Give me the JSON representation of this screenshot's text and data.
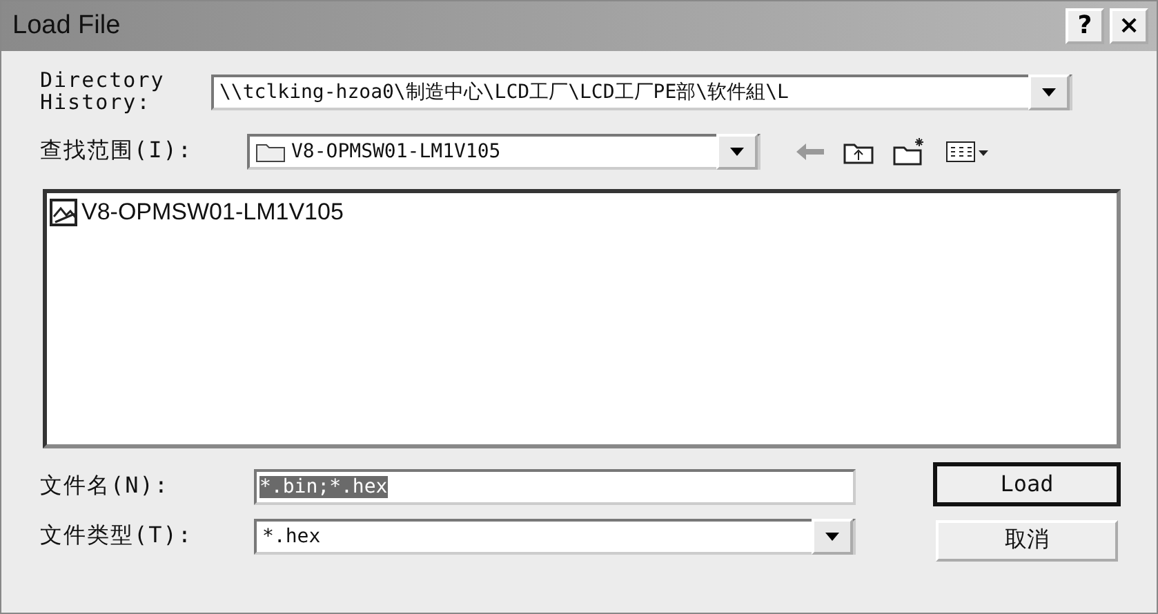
{
  "window": {
    "title": "Load File",
    "buttons": [
      {
        "label": "?"
      },
      {
        "label": "×"
      }
    ]
  },
  "directory_history": {
    "label": "Directory History:",
    "value": "\\\\tclking-hzoa0\\制造中心\\LCD工厂\\LCD工厂PE部\\软件組\\L"
  },
  "look_in": {
    "label": "查找范围(I):",
    "value": "V8-OPMSW01-LM1V105"
  },
  "file_list": [
    {
      "name": "V8-OPMSW01-LM1V105",
      "selected": false
    }
  ],
  "file_name": {
    "label": "文件名(N):",
    "value": "*.bin;*.hex",
    "text_selected": true
  },
  "file_type": {
    "label": "文件类型(T):",
    "value": "*.hex"
  },
  "buttons": [
    {
      "label": "Load",
      "default": true
    },
    {
      "label": "取消",
      "default": false
    }
  ]
}
